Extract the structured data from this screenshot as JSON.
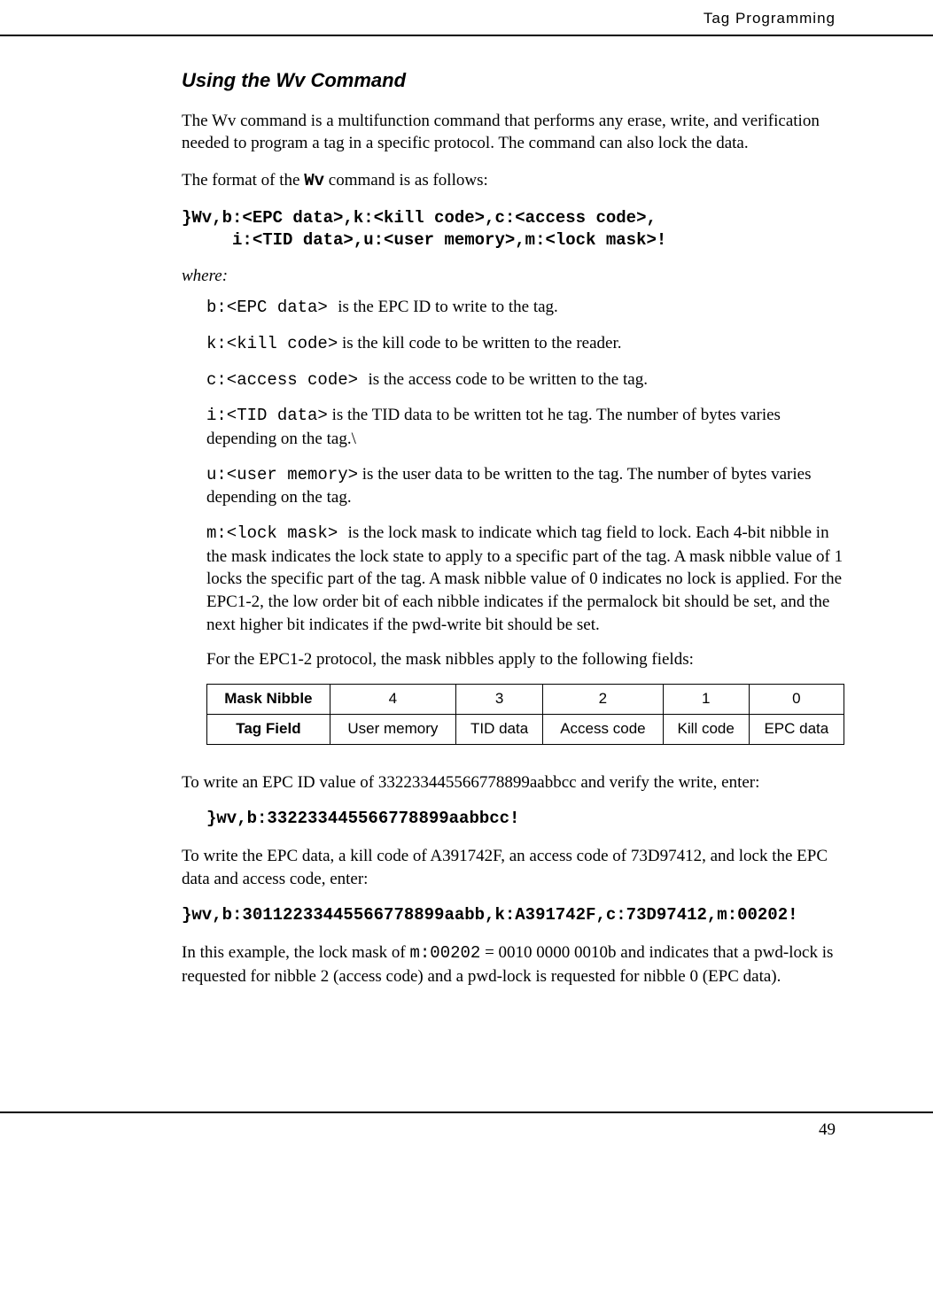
{
  "header": {
    "section_title": "Tag Programming"
  },
  "title": "Using the Wv Command",
  "intro_p1": "The Wv command is a multifunction command that performs any erase, write, and verification needed to program a tag in a specific protocol. The command can also lock the data.",
  "intro_p2_pre": "The format of the ",
  "intro_p2_cmd": "Wv",
  "intro_p2_post": " command is as follows:",
  "syntax_line1": "}Wv,b:<EPC data>,k:<kill code>,c:<access code>,",
  "syntax_line2": "     i:<TID data>,u:<user memory>,m:<lock mask>!",
  "where_label": "where:",
  "params": {
    "b": {
      "code": "b:<EPC data> ",
      "desc": " is the EPC ID to write to the tag."
    },
    "k": {
      "code": "k:<kill code>",
      "desc": " is the kill code to be written to the reader."
    },
    "c": {
      "code": "c:<access code> ",
      "desc": " is the access code to be written to the tag."
    },
    "i": {
      "code": "i:<TID data>",
      "desc": " is the TID data to be written tot he tag. The number of bytes varies depending on the tag.\\"
    },
    "u": {
      "code": "u:<user memory>",
      "desc": " is the user data to be written to the tag. The number of bytes varies depending on the tag."
    },
    "m": {
      "code": "m:<lock mask> ",
      "desc": " is the lock mask to indicate which tag field to lock. Each 4-bit nibble in the mask indicates the lock state to apply to a specific part of the tag. A mask nibble value of 1 locks the specific part of the tag. A mask nibble value of 0 indicates no lock is applied. For the EPC1-2, the low order bit of each nibble indicates if the permalock bit should be set, and the next higher bit indicates if the pwd-write bit should be set."
    }
  },
  "table_caption": "For the EPC1-2 protocol, the mask nibbles apply to the following fields:",
  "table": {
    "row1_label": "Mask Nibble",
    "row1": [
      "4",
      "3",
      "2",
      "1",
      "0"
    ],
    "row2_label": "Tag Field",
    "row2": [
      "User memory",
      "TID data",
      "Access code",
      "Kill code",
      "EPC data"
    ]
  },
  "ex1_text": "To write an EPC ID value of 332233445566778899aabbcc and verify the write, enter:",
  "ex1_code": "}wv,b:332233445566778899aabbcc!",
  "ex2_text": "To write the EPC data, a kill code of A391742F, an access code of 73D97412, and lock the EPC data and access code, enter:",
  "ex2_code": "}wv,b:30112233445566778899aabb,k:A391742F,c:73D97412,m:00202!",
  "ex3_pre": "In this example, the lock mask of ",
  "ex3_code": "m:00202",
  "ex3_post": " = 0010 0000 0010b and indicates that a pwd-lock is requested for nibble 2 (access code) and a pwd-lock is requested for nibble 0 (EPC data).",
  "footer": {
    "page": "49"
  }
}
